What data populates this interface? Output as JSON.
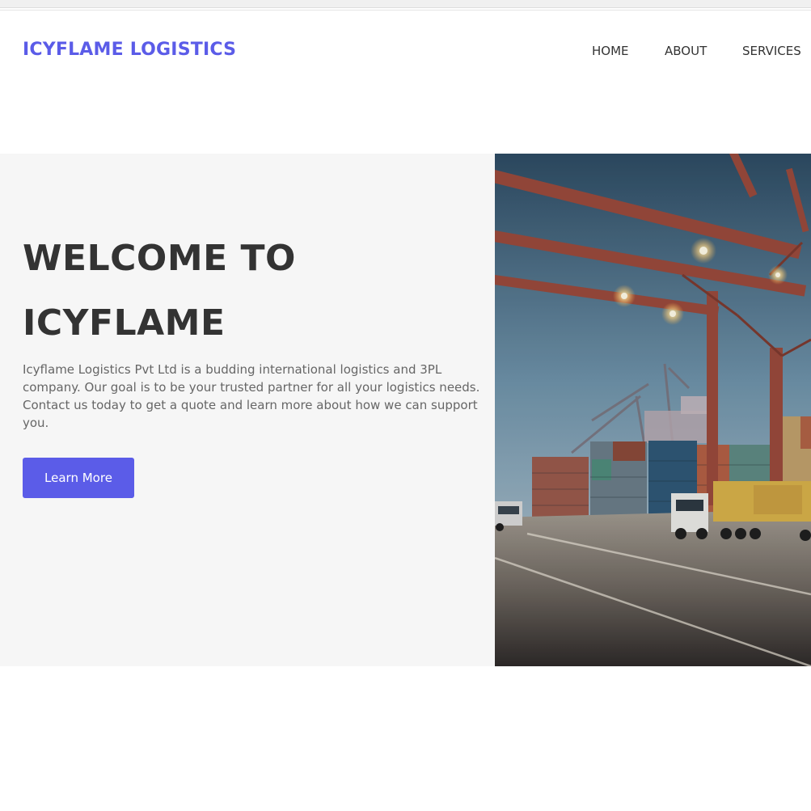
{
  "header": {
    "logo": "ICYFLAME LOGISTICS",
    "nav": [
      {
        "label": "HOME"
      },
      {
        "label": "ABOUT"
      },
      {
        "label": "SERVICES"
      }
    ]
  },
  "hero": {
    "title_line1": "WELCOME TO",
    "title_line2": "ICYFLAME",
    "description": "Icyflame Logistics Pvt Ltd is a budding international logistics and 3PL company. Our goal is to be your trusted partner for all your logistics needs. Contact us today to get a quote and learn more about how we can support you.",
    "cta_label": "Learn More",
    "image": "port-container-terminal-photo"
  },
  "colors": {
    "brand": "#5b5ce8",
    "heading": "#333333",
    "body_text": "#666666",
    "hero_bg": "#f6f6f6"
  }
}
